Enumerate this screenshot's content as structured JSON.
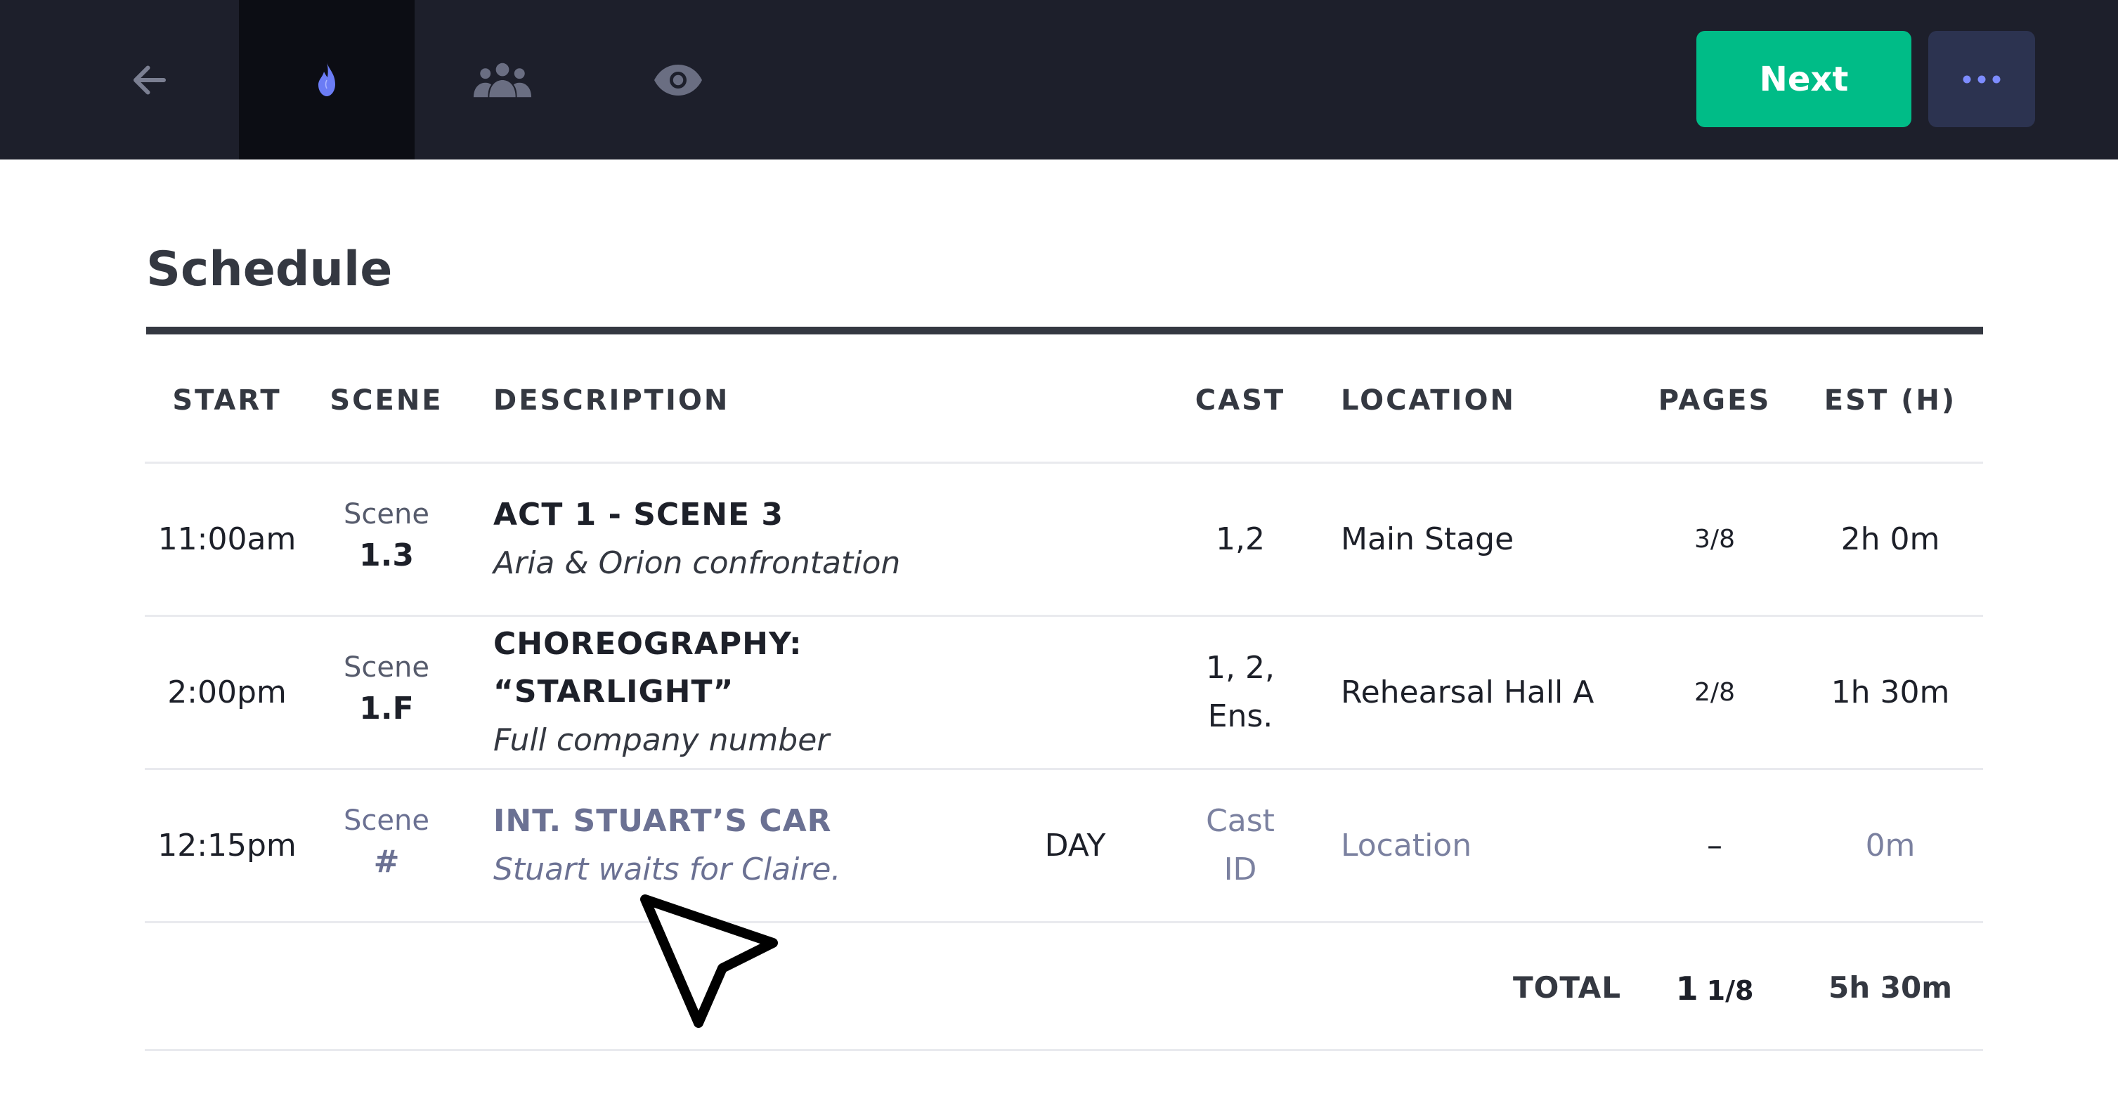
{
  "toolbar": {
    "icons": [
      "arrow-left-icon",
      "flame-icon",
      "group-icon",
      "eye-icon"
    ],
    "active_icon": "flame-icon",
    "next_label": "Next",
    "more_icon": "more-dots-icon",
    "colors": {
      "bar": "#1d1f2b",
      "next": "#00bc87",
      "more": "#2c3350",
      "active_icon": "#6b7cf5"
    }
  },
  "schedule": {
    "title": "Schedule",
    "columns": {
      "start": "START",
      "scene": "SCENE",
      "description": "DESCRIPTION",
      "cast": "CAST",
      "location": "LOCATION",
      "pages": "PAGES",
      "est": "EST (H)"
    },
    "rows": [
      {
        "start": "11:00am",
        "scene_label": "Scene",
        "scene_num": "1.3",
        "desc_title": "ACT 1 - SCENE 3",
        "desc_sub": "Aria & Orion confrontation",
        "day_night": "",
        "cast_line1": "1,2",
        "cast_line2": "",
        "location": "Main Stage",
        "pages": "3/8",
        "est": "2h 0m"
      },
      {
        "start": "2:00pm",
        "scene_label": "Scene",
        "scene_num": "1.F",
        "desc_title": "CHOREOGRAPHY: “STARLIGHT”",
        "desc_sub": "Full company number",
        "day_night": "",
        "cast_line1": "1, 2,",
        "cast_line2": "Ens.",
        "location": "Rehearsal Hall A",
        "pages": "2/8",
        "est": "1h 30m"
      },
      {
        "start": "12:15pm",
        "scene_label": "Scene",
        "scene_num": "#",
        "desc_title": "INT. STUART’S CAR",
        "desc_sub": "Stuart waits for Claire.",
        "day_night": "DAY",
        "cast_line1": "Cast",
        "cast_line2": "ID",
        "location": "Location",
        "pages": "–",
        "est": "0m"
      }
    ],
    "total": {
      "label": "TOTAL",
      "pages_whole": "1",
      "pages_frac": "1/8",
      "est": "5h 30m"
    }
  }
}
